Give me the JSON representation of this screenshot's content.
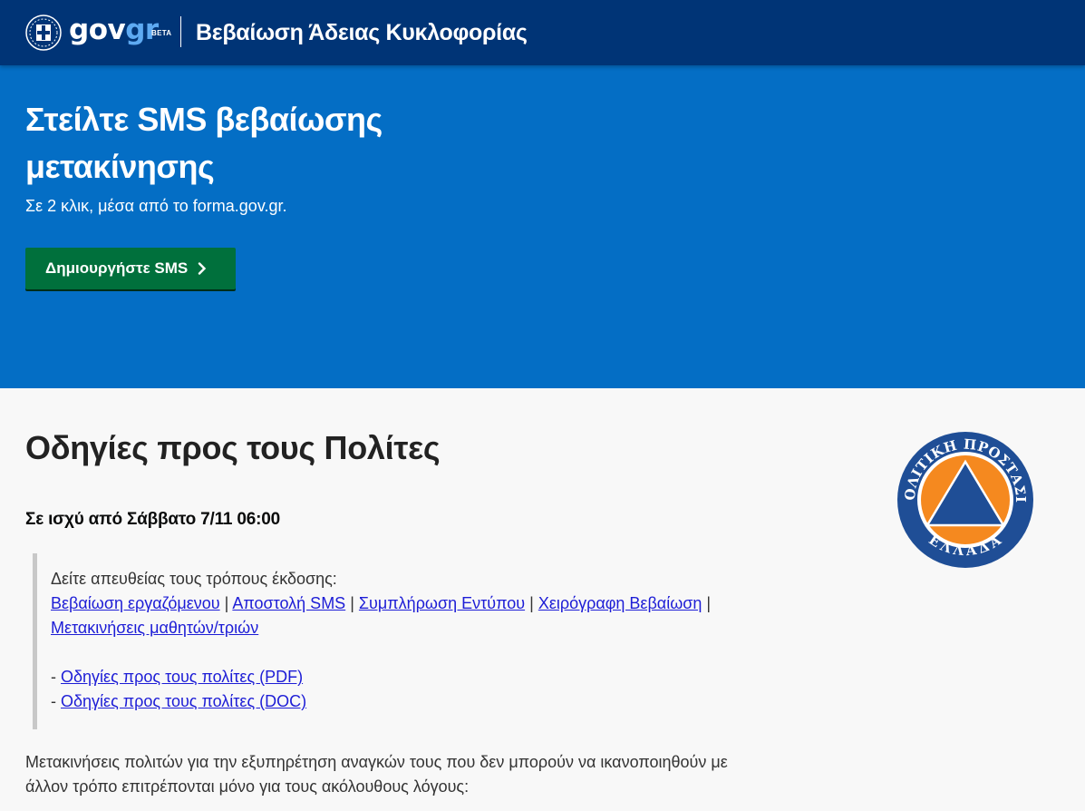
{
  "header": {
    "logo_prefix": "gov",
    "logo_suffix": "gr",
    "logo_badge": "BETA",
    "title": "Βεβαίωση Άδειας Κυκλοφορίας"
  },
  "hero": {
    "title": "Στείλτε SMS βεβαίωσης μετακίνησης",
    "subtitle": "Σε 2 κλικ, μέσα από το forma.gov.gr.",
    "button_label": "Δημιουργήστε SMS"
  },
  "content": {
    "title": "Οδηγίες προς τους Πολίτες",
    "effective": "Σε ισχύ από Σάββατο 7/11 06:00",
    "quote": {
      "intro": "Δείτε απευθείας τους τρόπους έκδοσης:",
      "links": [
        "Βεβαίωση εργαζόμενου",
        "Αποστολή SMS",
        "Συμπλήρωση Εντύπου",
        "Χειρόγραφη Βεβαίωση",
        "Μετακινήσεις μαθητών/τριών"
      ],
      "separator": "|",
      "dash": "-",
      "docs": [
        "Οδηγίες προς τους πολίτες (PDF)",
        "Οδηγίες προς τους πολίτες (DOC)"
      ]
    },
    "paragraph": "Μετακινήσεις πολιτών για την εξυπηρέτηση αναγκών τους που δεν μπορούν να ικανοποιηθούν με άλλον τρόπο επιτρέπονται μόνο για τους ακόλουθους λόγους:"
  },
  "civil_protection_logo": {
    "top_text": "ΠΟΛΙΤΙΚΗ ΠΡΟΣΤΑΣΙΑ",
    "bottom_text": "ΕΛΛΑΔΑ"
  },
  "colors": {
    "header_bg": "#003476",
    "hero_bg": "#046ec5",
    "button_bg": "#00703c",
    "link": "#1d1dd6",
    "logo_accent": "#5eaaf2",
    "civil_blue": "#1f4e96",
    "civil_orange": "#f5891f"
  },
  "icons": [
    "greek-emblem-icon",
    "chevron-right-icon",
    "civil-protection-logo"
  ]
}
